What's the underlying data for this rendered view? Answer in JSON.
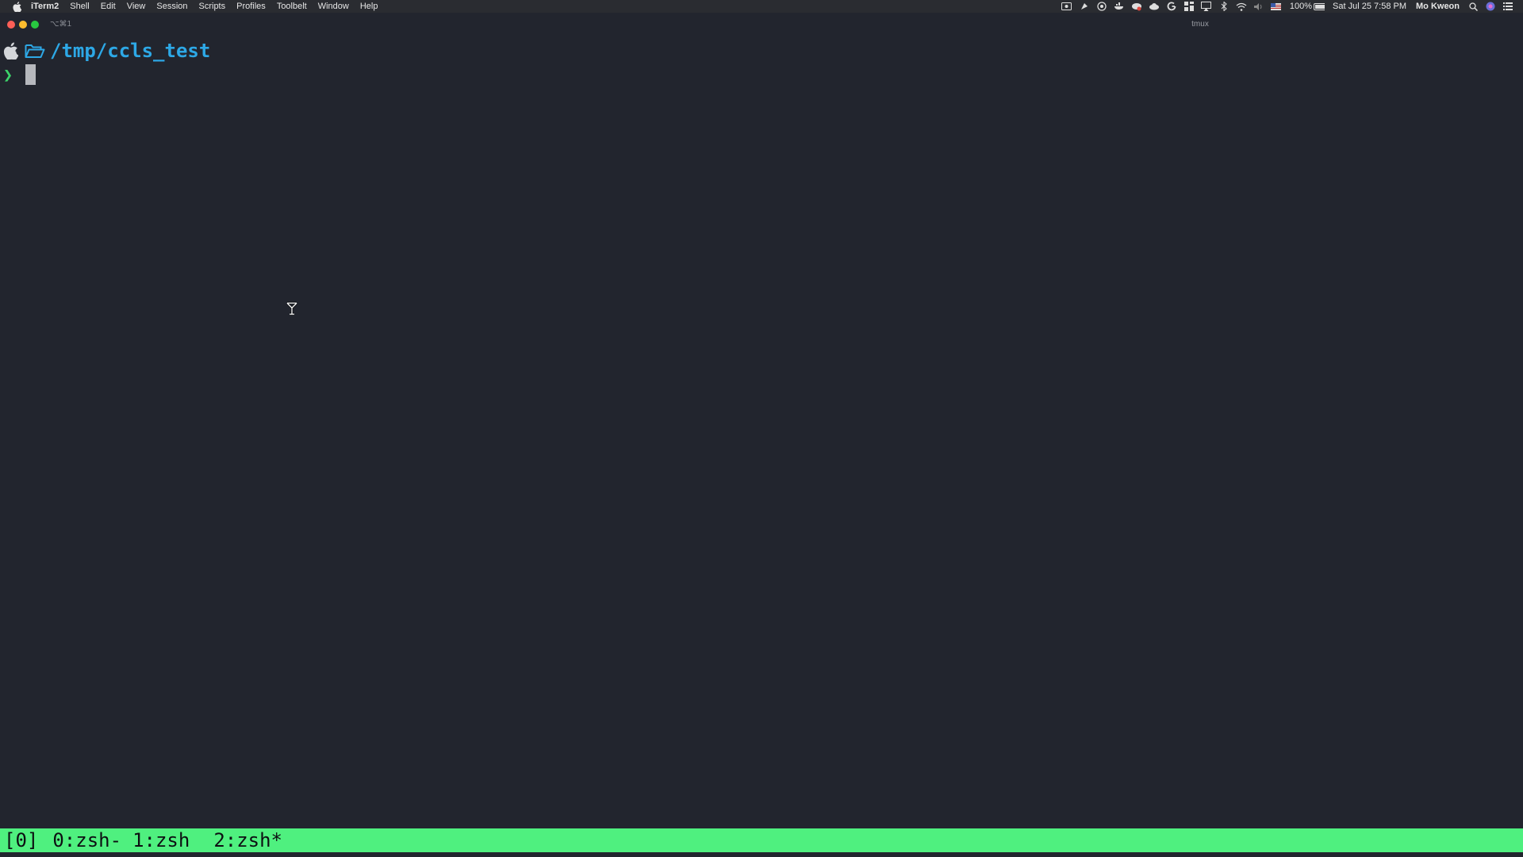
{
  "menubar": {
    "app_name": "iTerm2",
    "items": [
      "Shell",
      "Edit",
      "View",
      "Session",
      "Scripts",
      "Profiles",
      "Toolbelt",
      "Window",
      "Help"
    ],
    "status_icons": [
      "screen-record-icon",
      "paint-icon",
      "compass-icon",
      "docker-icon",
      "cloud-sync-icon",
      "cloud-icon",
      "google-icon",
      "grid-icon",
      "airplay-icon",
      "bluetooth-icon",
      "wifi-icon",
      "volume-icon",
      "us-flag-icon"
    ],
    "battery": "100%",
    "datetime": "Sat Jul 25  7:58 PM",
    "user": "Mo Kweon"
  },
  "window": {
    "shortcut": "⌥⌘1",
    "title": "tmux"
  },
  "terminal": {
    "path": "/tmp/ccls_test",
    "prompt_symbol": "❯"
  },
  "tmux": {
    "session": "[0]",
    "windows": [
      "0:zsh-",
      "1:zsh",
      "2:zsh*"
    ]
  },
  "colors": {
    "background": "#22252e",
    "path": "#2da8e6",
    "prompt": "#3cd46a",
    "tmux_bar": "#4ff07f"
  }
}
